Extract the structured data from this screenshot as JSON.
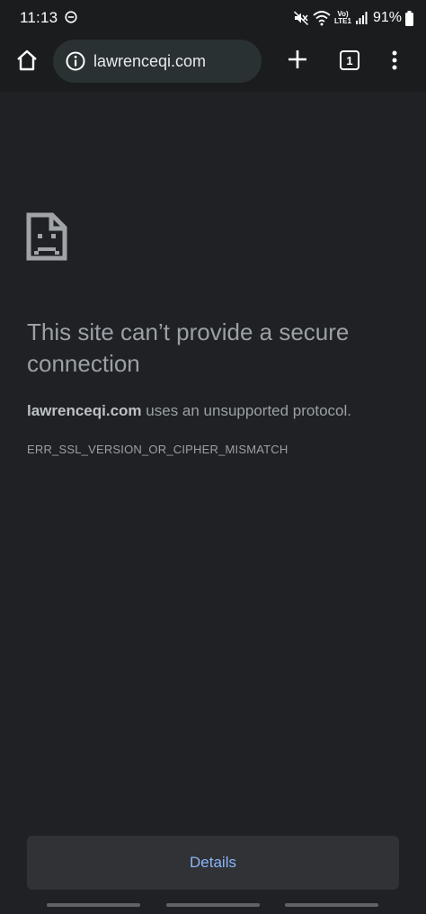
{
  "status_bar": {
    "time": "11:13",
    "network_label_top": "Vo)",
    "network_label_bottom": "LTE1",
    "battery": "91%",
    "icons": [
      "do-not-disturb-icon",
      "mute-icon",
      "wifi-icon",
      "volte-icon",
      "signal-icon",
      "battery-icon"
    ]
  },
  "toolbar": {
    "url": "lawrenceqi.com",
    "tab_count": "1",
    "icons": [
      "home-icon",
      "info-icon",
      "plus-icon",
      "tab-switcher-icon",
      "more-vert-icon"
    ]
  },
  "error": {
    "title": "This site can’t provide a secure connection",
    "host": "lawrenceqi.com",
    "message": " uses an unsupported protocol.",
    "code": "ERR_SSL_VERSION_OR_CIPHER_MISMATCH"
  },
  "details_button": {
    "label": "Details"
  },
  "colors": {
    "background": "#202124",
    "toolbar": "#1b1c1e",
    "omnibox": "#2a3133",
    "title_text": "#9aa0a6",
    "link": "#8ab4f8"
  }
}
